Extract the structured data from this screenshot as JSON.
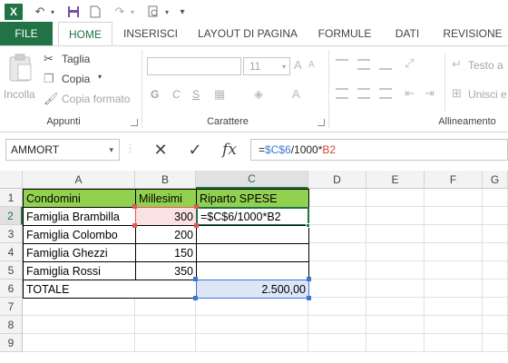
{
  "quick_access": {
    "app_icon": "X",
    "undo": "↶",
    "redo": "↷",
    "dropdown": "▾"
  },
  "tabs": {
    "file": "FILE",
    "home": "HOME",
    "inserisci": "INSERISCI",
    "layout": "LAYOUT DI PAGINA",
    "formule": "FORMULE",
    "dati": "DATI",
    "revisione": "REVISIONE"
  },
  "ribbon": {
    "clipboard": {
      "paste_label": "Incolla",
      "cut_label": "Taglia",
      "copy_label": "Copia",
      "format_painter_label": "Copia formato",
      "group_label": "Appunti"
    },
    "font": {
      "size_value": "11",
      "bold": "G",
      "italic": "C",
      "underline": "S",
      "group_label": "Carattere"
    },
    "alignment": {
      "wrap_text": "Testo a",
      "merge": "Unisci e",
      "group_label": "Allineamento"
    }
  },
  "formula_bar": {
    "name_box": "AMMORT",
    "cancel_icon": "✕",
    "enter_icon": "✓",
    "fx": "fx",
    "formula_parts": {
      "prefix": "=",
      "ref1": "$C$6",
      "middle": "/1000*",
      "ref2": "B2"
    }
  },
  "grid": {
    "columns": [
      "A",
      "B",
      "C",
      "D",
      "E",
      "F",
      "G"
    ],
    "rows": [
      "1",
      "2",
      "3",
      "4",
      "5",
      "6",
      "7",
      "8",
      "9"
    ],
    "cells": {
      "A1": "Condomini",
      "B1": "Millesimi",
      "C1": "Riparto SPESE",
      "A2": "Famiglia Brambilla",
      "B2": "300",
      "C2": "=$C$6/1000*B2",
      "A3": "Famiglia Colombo",
      "B3": "200",
      "A4": "Famiglia Ghezzi",
      "B4": "150",
      "A5": "Famiglia Rossi",
      "B5": "350",
      "A6": "TOTALE",
      "C6": "2.500,00"
    }
  },
  "colors": {
    "accent": "#217346",
    "header_fill": "#92d050",
    "ref_blue": "#3f75d3",
    "ref_red": "#d8412f"
  }
}
